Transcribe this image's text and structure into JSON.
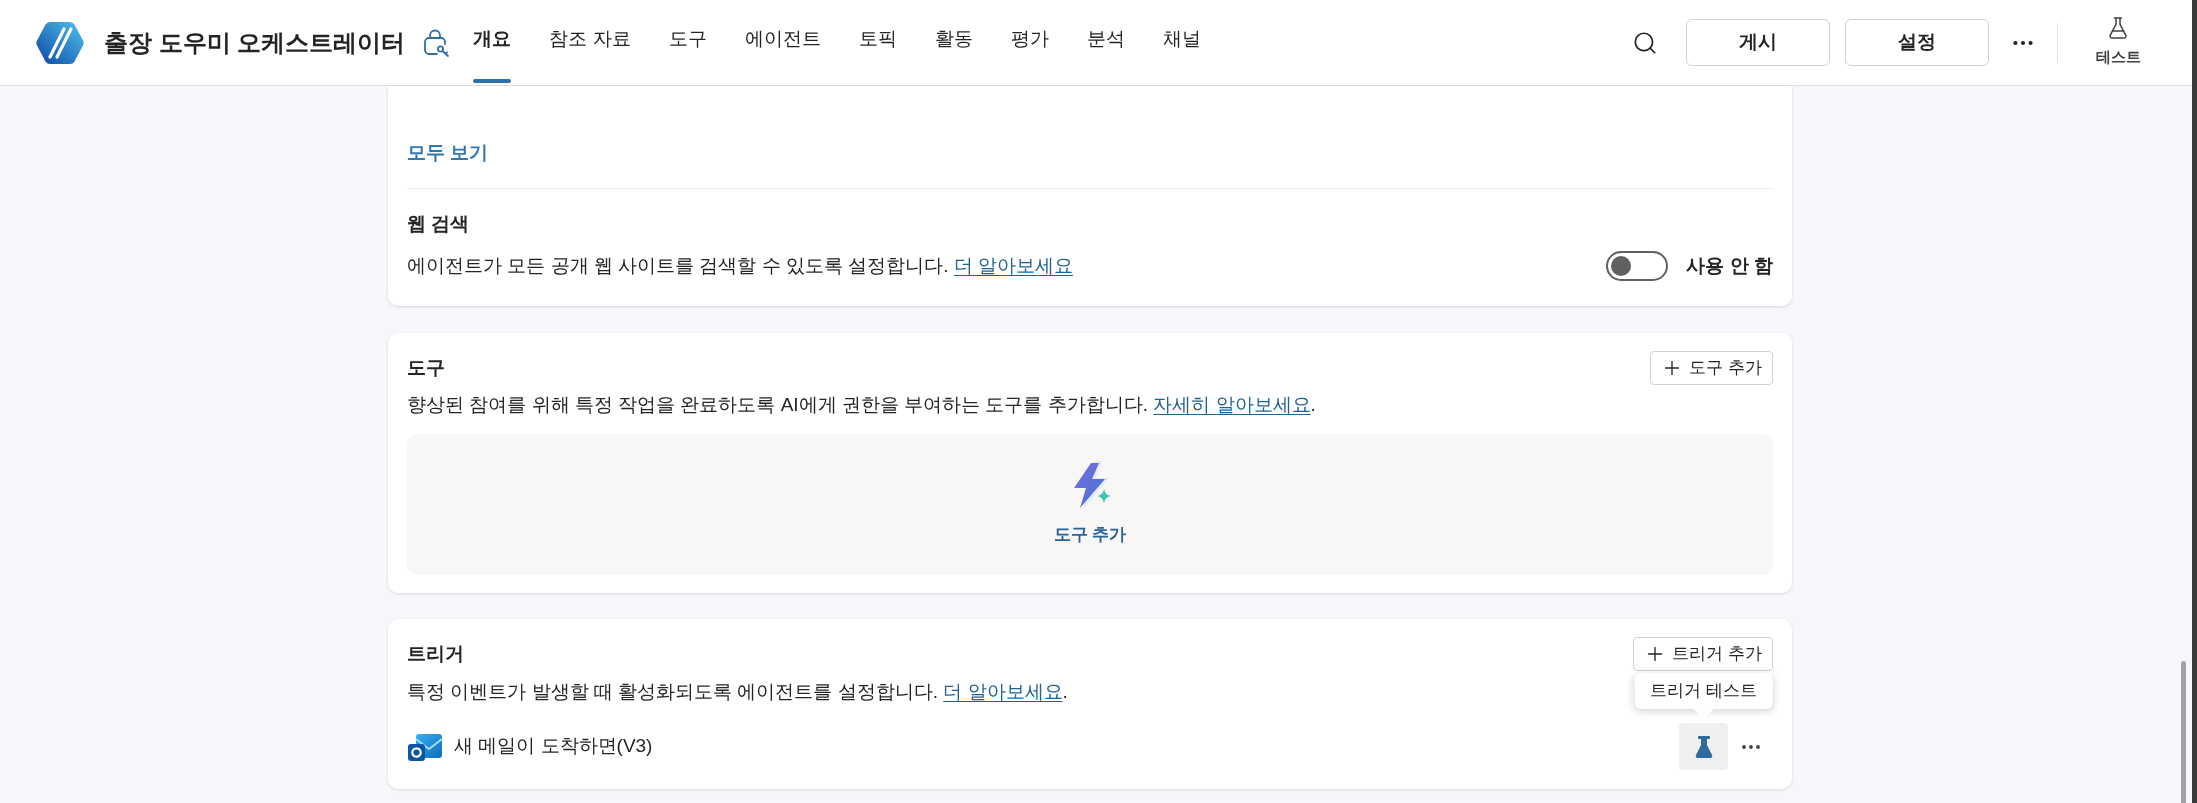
{
  "app": {
    "title": "출장 도우미 오케스트레이터"
  },
  "tabs": [
    {
      "label": "개요",
      "selected": true
    },
    {
      "label": "참조 자료",
      "selected": false
    },
    {
      "label": "도구",
      "selected": false
    },
    {
      "label": "에이전트",
      "selected": false
    },
    {
      "label": "토픽",
      "selected": false
    },
    {
      "label": "활동",
      "selected": false
    },
    {
      "label": "평가",
      "selected": false
    },
    {
      "label": "분석",
      "selected": false
    },
    {
      "label": "채널",
      "selected": false
    }
  ],
  "header_actions": {
    "buttons": [
      "게시",
      "설정"
    ],
    "test": "테스트"
  },
  "knowledge": {
    "view_all": "모두 보기",
    "web_search": {
      "title": "웹 검색",
      "description": "에이전트가 모든 공개 웹 사이트를 검색할 수 있도록 설정합니다.",
      "link": "더 알아보세요",
      "on": false,
      "status": "사용 안 함"
    }
  },
  "tools": {
    "title": "도구",
    "add_button": "도구 추가",
    "description": "향상된 참여를 위해 특정 작업을 완료하도록 AI에게 권한을 부여하는 도구를 추가합니다.",
    "link": "자세히 알아보세요",
    "after_link": ".",
    "empty_action": "도구 추가"
  },
  "triggers": {
    "title": "트리거",
    "add_button": "트리거 추가",
    "description": "특정 이벤트가 발생할 때 활성화되도록 에이전트를 설정합니다.",
    "link": "더 알아보세요",
    "after_link": ".",
    "items": [
      {
        "name": "새 메일이 도착하면(V3)",
        "tooltip": "트리거 테스트"
      }
    ]
  }
}
